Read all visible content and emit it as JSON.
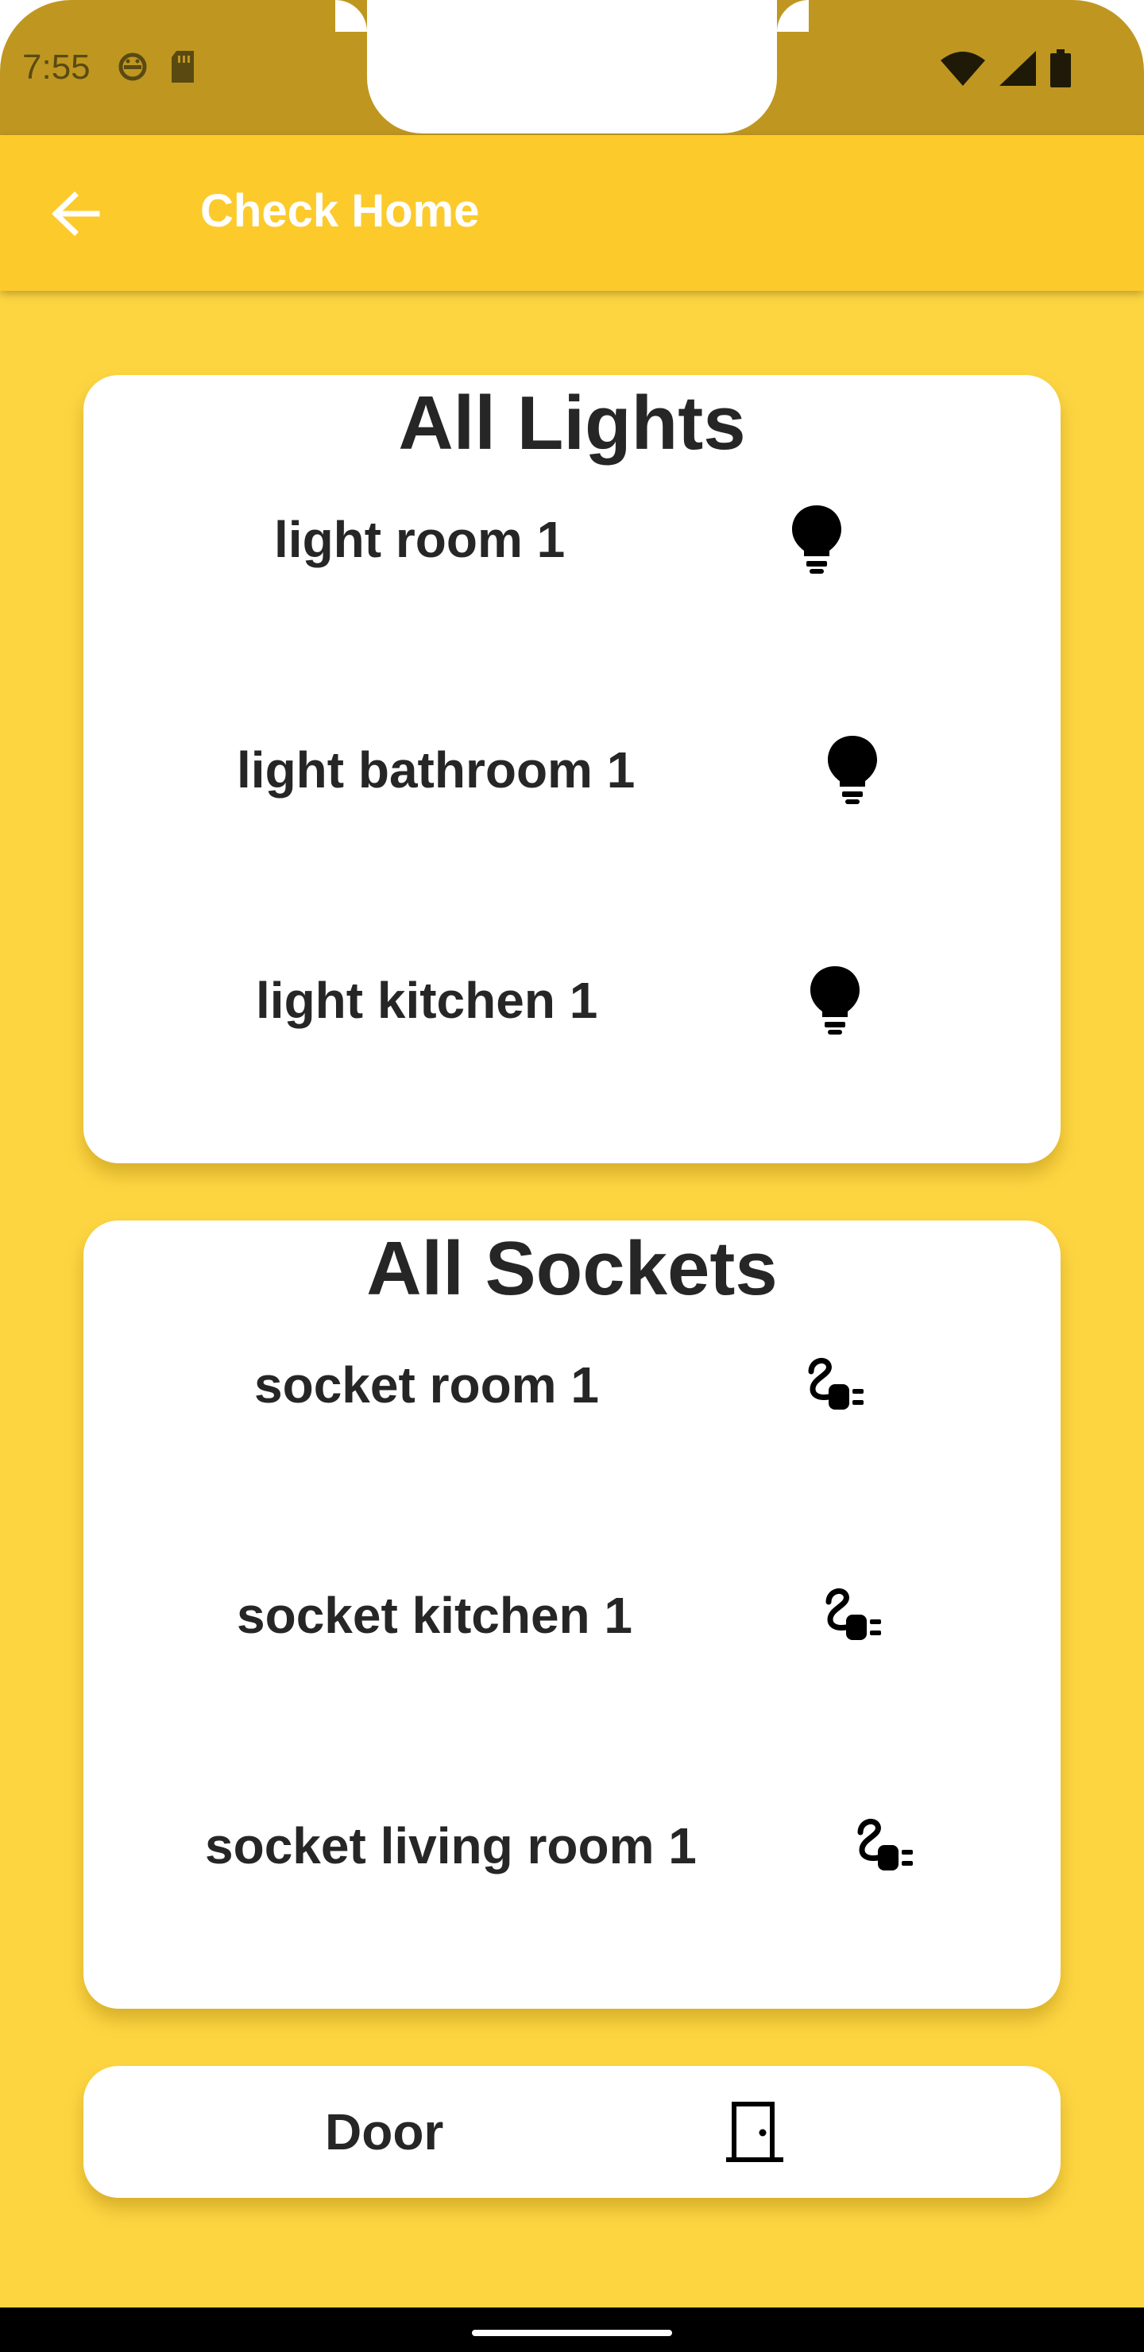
{
  "status_bar": {
    "time": "7:55",
    "left_icons": [
      "android-debug-icon",
      "sd-card-icon"
    ],
    "right_icons": [
      "wifi-icon",
      "cell-signal-icon",
      "battery-icon"
    ]
  },
  "app_bar": {
    "title": "Check Home",
    "back_icon": "arrow-left-icon"
  },
  "lights": {
    "title": "All Lights",
    "items": [
      {
        "label": "light room 1",
        "icon": "lightbulb-icon"
      },
      {
        "label": "light bathroom 1",
        "icon": "lightbulb-icon"
      },
      {
        "label": "light kitchen 1",
        "icon": "lightbulb-icon"
      }
    ]
  },
  "sockets": {
    "title": "All Sockets",
    "items": [
      {
        "label": "socket room 1",
        "icon": "power-plug-icon"
      },
      {
        "label": "socket kitchen 1",
        "icon": "power-plug-icon"
      },
      {
        "label": "socket living room 1",
        "icon": "power-plug-icon"
      }
    ]
  },
  "door": {
    "label": "Door",
    "icon": "door-icon"
  },
  "colors": {
    "background": "#fdd541",
    "app_bar": "#fdca2c",
    "status_bar": "#bf9720",
    "card": "#ffffff",
    "text": "#262626"
  }
}
